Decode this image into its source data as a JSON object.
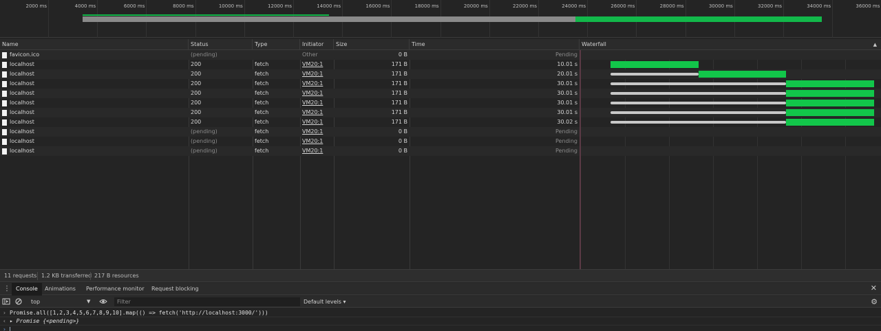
{
  "overview": {
    "tick_labels": [
      "2000 ms",
      "4000 ms",
      "6000 ms",
      "8000 ms",
      "10000 ms",
      "12000 ms",
      "14000 ms",
      "16000 ms",
      "18000 ms",
      "20000 ms",
      "22000 ms",
      "24000 ms",
      "26000 ms",
      "28000 ms",
      "30000 ms",
      "32000 ms",
      "34000 ms",
      "36000 ms"
    ],
    "colors": {
      "waiting": "#8a8a8a",
      "receiving": "#12b84a"
    }
  },
  "columns": {
    "name": "Name",
    "status": "Status",
    "type": "Type",
    "initiator": "Initiator",
    "size": "Size",
    "time": "Time",
    "waterfall": "Waterfall",
    "sort_icon": "sort-ascending-icon"
  },
  "rows": [
    {
      "name": "favicon.ico",
      "status": "(pending)",
      "type": "",
      "initiator": "Other",
      "size": "0 B",
      "time": "Pending"
    },
    {
      "name": "localhost",
      "status": "200",
      "type": "fetch",
      "initiator": "VM20:1",
      "size": "171 B",
      "time": "10.01 s"
    },
    {
      "name": "localhost",
      "status": "200",
      "type": "fetch",
      "initiator": "VM20:1",
      "size": "171 B",
      "time": "20.01 s"
    },
    {
      "name": "localhost",
      "status": "200",
      "type": "fetch",
      "initiator": "VM20:1",
      "size": "171 B",
      "time": "30.01 s"
    },
    {
      "name": "localhost",
      "status": "200",
      "type": "fetch",
      "initiator": "VM20:1",
      "size": "171 B",
      "time": "30.01 s"
    },
    {
      "name": "localhost",
      "status": "200",
      "type": "fetch",
      "initiator": "VM20:1",
      "size": "171 B",
      "time": "30.01 s"
    },
    {
      "name": "localhost",
      "status": "200",
      "type": "fetch",
      "initiator": "VM20:1",
      "size": "171 B",
      "time": "30.01 s"
    },
    {
      "name": "localhost",
      "status": "200",
      "type": "fetch",
      "initiator": "VM20:1",
      "size": "171 B",
      "time": "30.02 s"
    },
    {
      "name": "localhost",
      "status": "(pending)",
      "type": "fetch",
      "initiator": "VM20:1",
      "size": "0 B",
      "time": "Pending"
    },
    {
      "name": "localhost",
      "status": "(pending)",
      "type": "fetch",
      "initiator": "VM20:1",
      "size": "0 B",
      "time": "Pending"
    },
    {
      "name": "localhost",
      "status": "(pending)",
      "type": "fetch",
      "initiator": "VM20:1",
      "size": "0 B",
      "time": "Pending"
    }
  ],
  "summary": {
    "requests": "11 requests",
    "transferred": "1.2 KB transferred",
    "resources": "217 B resources"
  },
  "drawer": {
    "menu_icon": "more-vertical-icon",
    "tabs": [
      "Console",
      "Animations",
      "Performance monitor",
      "Request blocking"
    ],
    "active_tab": "Console",
    "close_icon": "close-icon"
  },
  "console_toolbar": {
    "context": "top",
    "filter_placeholder": "Filter",
    "levels": "Default levels ▾"
  },
  "console": {
    "input_code": "Promise.all([1,2,3,4,5,6,7,8,9,10].map(() => fetch('http://localhost:3000/')))",
    "result_label": "Promise",
    "result_value": "{<pending>}"
  }
}
